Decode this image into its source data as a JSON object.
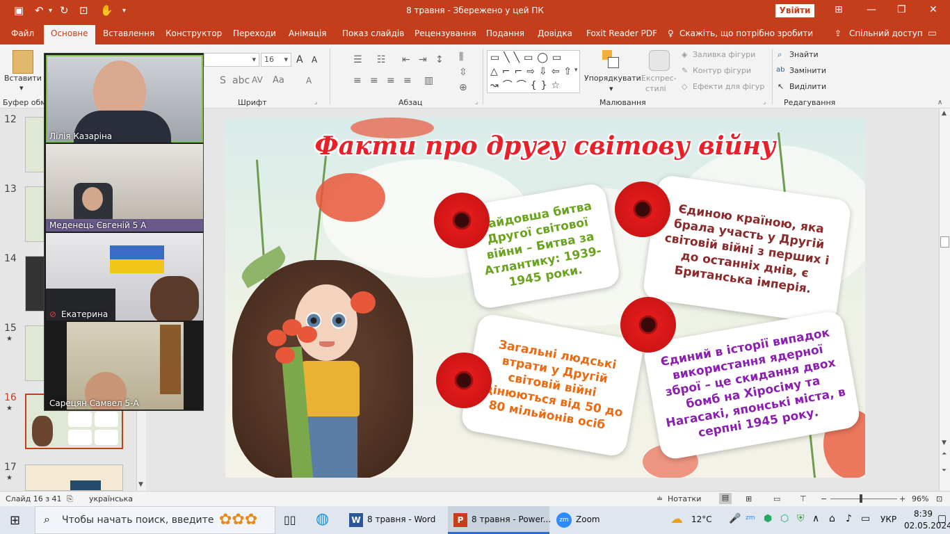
{
  "window": {
    "doc_title": "8 травня  -  Збережено у цей ПК",
    "sign_in": "Увійти"
  },
  "tabs": [
    {
      "label": "Файл"
    },
    {
      "label": "Основне"
    },
    {
      "label": "Вставлення"
    },
    {
      "label": "Конструктор"
    },
    {
      "label": "Переходи"
    },
    {
      "label": "Анімація"
    },
    {
      "label": "Показ слайдів"
    },
    {
      "label": "Рецензування"
    },
    {
      "label": "Подання"
    },
    {
      "label": "Довідка"
    },
    {
      "label": "Foxit Reader PDF"
    },
    {
      "label": "Скажіть, що потрібно зробити"
    },
    {
      "label": "Спільний доступ"
    }
  ],
  "ribbon": {
    "paste": "Вставити",
    "clipboard": "Буфер обм",
    "font_size": "16",
    "font_group": "Шрифт",
    "paragraph_group": "Абзац",
    "arrange": "Упорядкувати",
    "quick_styles_1": "Експрес-",
    "quick_styles_2": "стилі",
    "shape_fill": "Заливка фігури",
    "shape_outline": "Контур фігури",
    "shape_effects": "Ефекти для фігур",
    "drawing_group": "Малювання",
    "find": "Знайти",
    "replace": "Замінити",
    "select": "Виділити",
    "editing_group": "Редагування"
  },
  "slides_pane": {
    "items": [
      {
        "num": "12",
        "star": ""
      },
      {
        "num": "13",
        "star": ""
      },
      {
        "num": "14",
        "star": ""
      },
      {
        "num": "15",
        "star": "★"
      },
      {
        "num": "16",
        "star": "★"
      },
      {
        "num": "17",
        "star": "★"
      }
    ]
  },
  "slide": {
    "title": "Факти про другу світову війну",
    "fact1": "Найдовша битва Другої світової війни – Битва за Атлантику: 1939-1945 роки.",
    "fact2": "Єдиною країною, яка брала участь у Другій світовій війні з перших і до останніх днів, є Британська імперія.",
    "fact3": "Загальні людські втрати у Другій світовій війні оцінюються від 50 до 80 мільйонів осіб",
    "fact4": "Єдиний в історії випадок використання ядерної зброї – це скидання двох бомб на Хіросіму та Нагасакі, японські міста, в серпні 1945 року.",
    "colors": {
      "fact1": "#6aa31e",
      "fact2": "#8a2a2a",
      "fact3": "#ec6a12",
      "fact4": "#8a1fb0",
      "title": "#e8202a"
    }
  },
  "zoom": {
    "participants": [
      {
        "name": "Лілія Казаріна",
        "muted": false
      },
      {
        "name": "Меденець Євгеній 5 А",
        "muted": false
      },
      {
        "name": "Екатерина",
        "muted": true
      },
      {
        "name": "Сарецян Самвел 5-А",
        "muted": false
      }
    ]
  },
  "status": {
    "slide": "Слайд 16 з 41",
    "language": "українська",
    "notes": "Нотатки",
    "zoom": "96%"
  },
  "taskbar": {
    "search": "Чтобы начать поиск, введите",
    "apps": [
      {
        "label": "8 травня - Word"
      },
      {
        "label": "8 травня - Power..."
      },
      {
        "label": "Zoom"
      }
    ],
    "weather": "12°C",
    "lang": "УКР",
    "time": "8:39",
    "date": "02.05.2024"
  }
}
